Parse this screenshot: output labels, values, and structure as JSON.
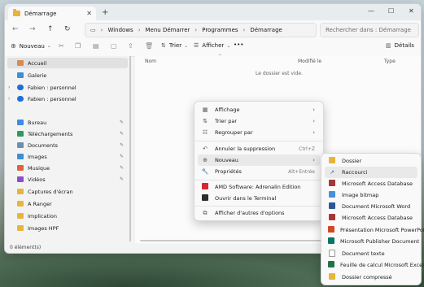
{
  "window": {
    "tab_title": "Démarrage",
    "new_tab": "+",
    "controls": {
      "minimize": "—",
      "maximize": "☐",
      "close": "✕"
    }
  },
  "nav": {
    "breadcrumb": [
      "Windows",
      "Menu Démarrer",
      "Programmes",
      "Démarrage"
    ],
    "search_placeholder": "Rechercher dans : Démarrage"
  },
  "toolbar": {
    "new_label": "Nouveau",
    "sort_label": "Trier",
    "view_label": "Afficher",
    "more_label": "•••",
    "details_label": "Détails"
  },
  "sidebar": {
    "items": [
      {
        "label": "Accueil",
        "icon": "home-icon",
        "selected": true
      },
      {
        "label": "Galerie",
        "icon": "gallery-icon"
      },
      {
        "label": "Fabien : personnel",
        "icon": "onedrive-icon"
      },
      {
        "label": "Fabien : personnel",
        "icon": "onedrive-icon"
      },
      {
        "label": "Bureau",
        "icon": "desktop-icon"
      },
      {
        "label": "Téléchargements",
        "icon": "download-icon"
      },
      {
        "label": "Documents",
        "icon": "documents-icon"
      },
      {
        "label": "Images",
        "icon": "images-icon"
      },
      {
        "label": "Musique",
        "icon": "music-icon"
      },
      {
        "label": "Vidéos",
        "icon": "videos-icon"
      },
      {
        "label": "Captures d'écran",
        "icon": "folder-icon"
      },
      {
        "label": "A Ranger",
        "icon": "folder-icon"
      },
      {
        "label": "Implication",
        "icon": "folder-icon"
      },
      {
        "label": "Images HPF",
        "icon": "folder-icon"
      }
    ]
  },
  "main": {
    "columns": [
      "Nom",
      "Modifié le",
      "Type"
    ],
    "empty_message": "Le dossier est vide."
  },
  "status": {
    "count": "0 élément(s)"
  },
  "context_menu": {
    "items": [
      {
        "label": "Affichage",
        "icon": "view-icon",
        "arrow": "›"
      },
      {
        "label": "Trier par",
        "icon": "sort-icon",
        "arrow": "›"
      },
      {
        "label": "Regrouper par",
        "icon": "group-icon",
        "arrow": "›"
      },
      {
        "label": "Annuler la suppression",
        "icon": "undo-icon",
        "shortcut": "Ctrl+Z"
      },
      {
        "label": "Nouveau",
        "icon": "new-icon",
        "arrow": "›"
      },
      {
        "label": "Propriétés",
        "icon": "properties-icon",
        "shortcut": "Alt+Entrée"
      },
      {
        "label": "AMD Software: Adrenalin Edition",
        "icon": "amd-icon"
      },
      {
        "label": "Ouvrir dans le Terminal",
        "icon": "terminal-icon"
      },
      {
        "label": "Afficher d'autres d'options",
        "icon": "more-options-icon"
      }
    ]
  },
  "submenu": {
    "items": [
      {
        "label": "Dossier",
        "icon": "folder-icon"
      },
      {
        "label": "Raccourci",
        "icon": "shortcut-icon"
      },
      {
        "label": "Microsoft Access Database",
        "icon": "access-icon"
      },
      {
        "label": "Image bitmap",
        "icon": "bitmap-icon"
      },
      {
        "label": "Document Microsoft Word",
        "icon": "word-icon"
      },
      {
        "label": "Microsoft Access Database",
        "icon": "access-icon"
      },
      {
        "label": "Présentation Microsoft PowerPoint",
        "icon": "powerpoint-icon"
      },
      {
        "label": "Microsoft Publisher Document",
        "icon": "publisher-icon"
      },
      {
        "label": "Document texte",
        "icon": "text-icon"
      },
      {
        "label": "Feuille de calcul Microsoft Excel",
        "icon": "excel-icon"
      },
      {
        "label": "Dossier compressé",
        "icon": "zip-icon"
      }
    ]
  },
  "colors": {
    "folder": "#e8b53c",
    "onedrive": "#1e6fd9",
    "access": "#a4373a",
    "word": "#2b579a",
    "powerpoint": "#d24726",
    "publisher": "#077568",
    "excel": "#217346",
    "amd": "#d9262c"
  }
}
